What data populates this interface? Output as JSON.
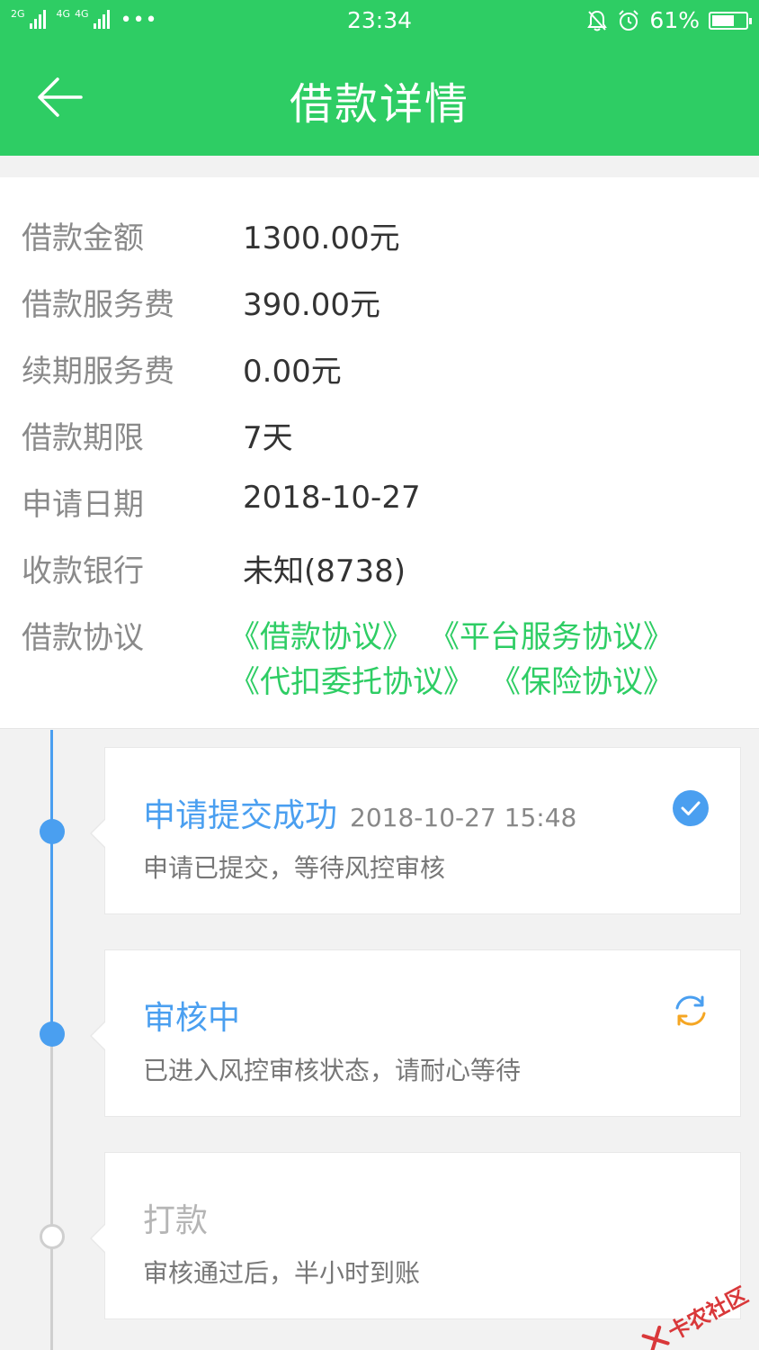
{
  "status_bar": {
    "network_1": "2G",
    "network_2": "4G",
    "network_3": "4G",
    "more": "•••",
    "time": "23:34",
    "battery": "61%"
  },
  "header": {
    "title": "借款详情"
  },
  "details": [
    {
      "label": "借款金额",
      "value": "1300.00元"
    },
    {
      "label": "借款服务费",
      "value": "390.00元"
    },
    {
      "label": "续期服务费",
      "value": "0.00元"
    },
    {
      "label": "借款期限",
      "value": "7天"
    },
    {
      "label": "申请日期",
      "value": "2018-10-27"
    },
    {
      "label": "收款银行",
      "value": "未知(8738)"
    }
  ],
  "agreements": {
    "label": "借款协议",
    "links": [
      "《借款协议》",
      "《平台服务协议》",
      "《代扣委托协议》",
      "《保险协议》"
    ]
  },
  "timeline": [
    {
      "title": "申请提交成功",
      "time": "2018-10-27 15:48",
      "desc": "申请已提交，等待风控审核",
      "state": "done",
      "icon": "check-circle-icon"
    },
    {
      "title": "审核中",
      "time": "",
      "desc": "已进入风控审核状态，请耐心等待",
      "state": "active",
      "icon": "refresh-icon"
    },
    {
      "title": "打款",
      "time": "",
      "desc": "审核通过后，半小时到账",
      "state": "pending",
      "icon": ""
    }
  ],
  "watermark": {
    "text": "卡农社区"
  },
  "colors": {
    "brand": "#2ecd64",
    "timeline_blue": "#4a9ff0",
    "review_orange": "#f5a623"
  }
}
